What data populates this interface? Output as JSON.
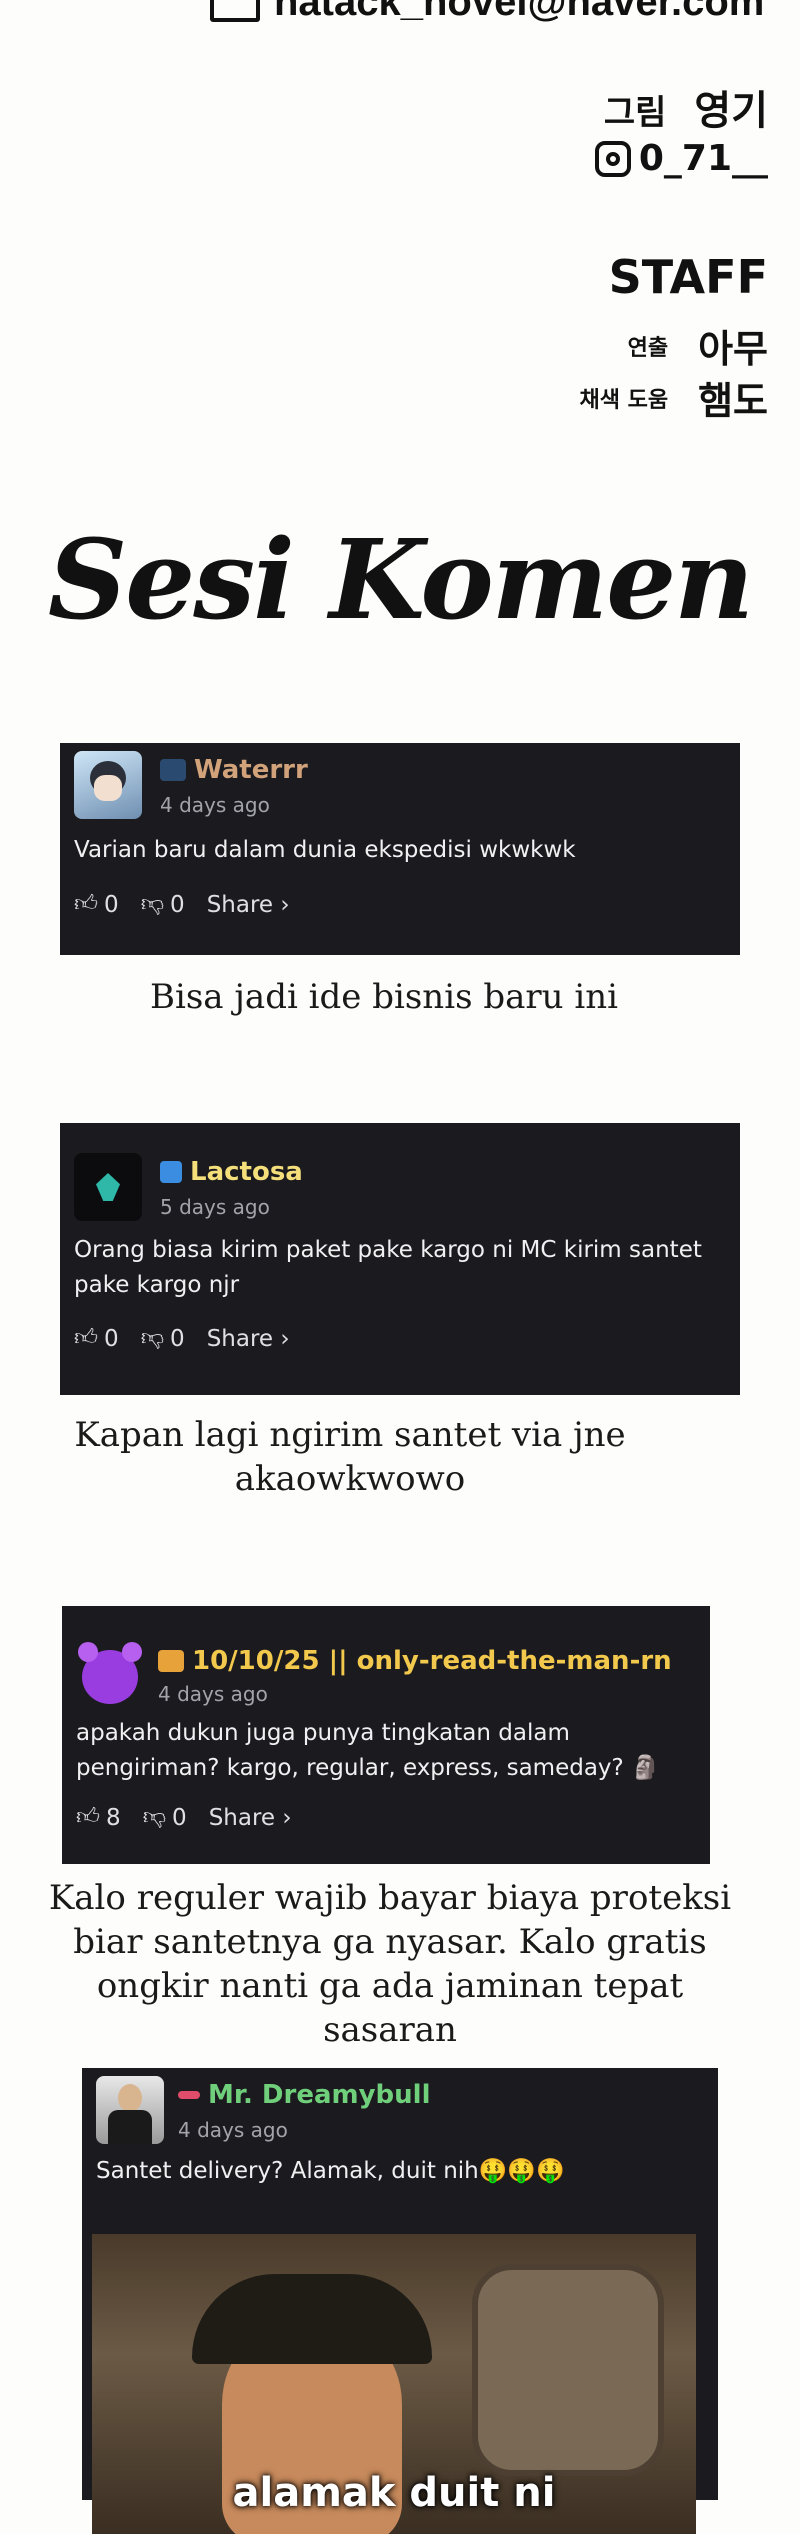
{
  "credits": {
    "email": "hatack_novel@naver.com",
    "art_label": "그림",
    "art_name": "영기",
    "instagram": "0_71__",
    "staff_title": "STAFF",
    "director_label": "연출",
    "director_name": "아무",
    "color_label": "채색 도움",
    "color_name": "햄도"
  },
  "section_title": "Sesi Komen",
  "comments": [
    {
      "username": "Waterrr",
      "name_color": "#d2a27a",
      "time": "4 days ago",
      "text": "Varian baru dalam dunia ekspedisi wkwkwk",
      "likes": "0",
      "dislikes": "0",
      "share": "Share ›",
      "caption": "Bisa jadi ide bisnis baru ini"
    },
    {
      "username": "Lactosa",
      "name_color": "#f4df7a",
      "time": "5 days ago",
      "text": "Orang biasa kirim paket pake kargo ni MC kirim santet pake kargo njr",
      "likes": "0",
      "dislikes": "0",
      "share": "Share ›",
      "caption": "Kapan lagi ngirim santet via jne akaowkwowo"
    },
    {
      "username": "10/10/25 || only-read-the-man-rn",
      "name_color": "#f2c94c",
      "time": "4 days ago",
      "text": "apakah dukun juga punya tingkatan dalam pengiriman? kargo, regular, express, sameday? 🗿",
      "likes": "8",
      "dislikes": "0",
      "share": "Share ›",
      "caption": "Kalo reguler wajib bayar biaya proteksi biar santetnya ga nyasar. Kalo gratis ongkir nanti ga ada jaminan tepat sasaran"
    },
    {
      "username": "Mr. Dreamybull",
      "name_color": "#6fcf7a",
      "time": "4 days ago",
      "text": "Santet delivery? Alamak, duit nih🤑🤑🤑",
      "meme_caption": "alamak duit ni"
    }
  ]
}
